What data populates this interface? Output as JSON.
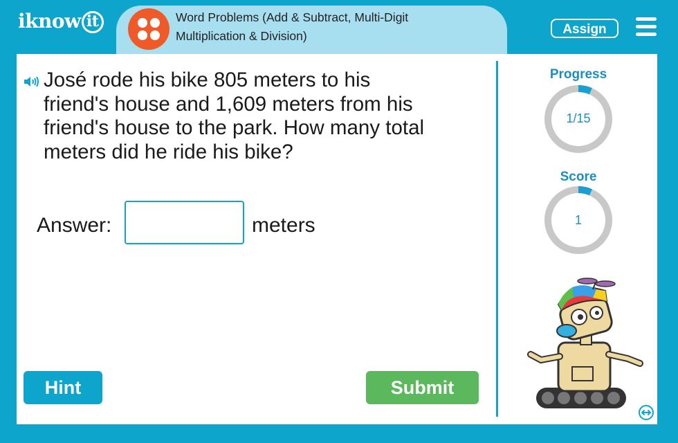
{
  "header": {
    "logo_prefix": "iknow",
    "logo_suffix": "it",
    "lesson_title_line1": "Word Problems (Add & Subtract, Multi-Digit",
    "lesson_title_line2": "Multiplication & Division)",
    "assign_label": "Assign",
    "menu_icon": "hamburger-menu-icon"
  },
  "question": {
    "audio_icon": "speaker-icon",
    "lines": [
      "José rode his bike 805 meters to his",
      "friend's house and 1,609 meters from his",
      "friend's house to the park. How many total",
      "meters did he ride his bike?"
    ]
  },
  "answer": {
    "label": "Answer:",
    "value": "",
    "unit": "meters"
  },
  "buttons": {
    "hint": "Hint",
    "submit": "Submit"
  },
  "sidebar": {
    "progress_label": "Progress",
    "progress_value": "1/15",
    "progress_fraction": 0.0667,
    "score_label": "Score",
    "score_value": "1",
    "score_fraction": 0.0667,
    "swap_icon": "swap-arrows-icon"
  },
  "colors": {
    "brand_blue": "#0ea5cc",
    "lesson_tab": "#a8dff0",
    "lesson_icon": "#f05a28",
    "submit_green": "#5cb85c",
    "ring_track": "#c8c8c8",
    "ring_fill": "#1a9fd0"
  }
}
